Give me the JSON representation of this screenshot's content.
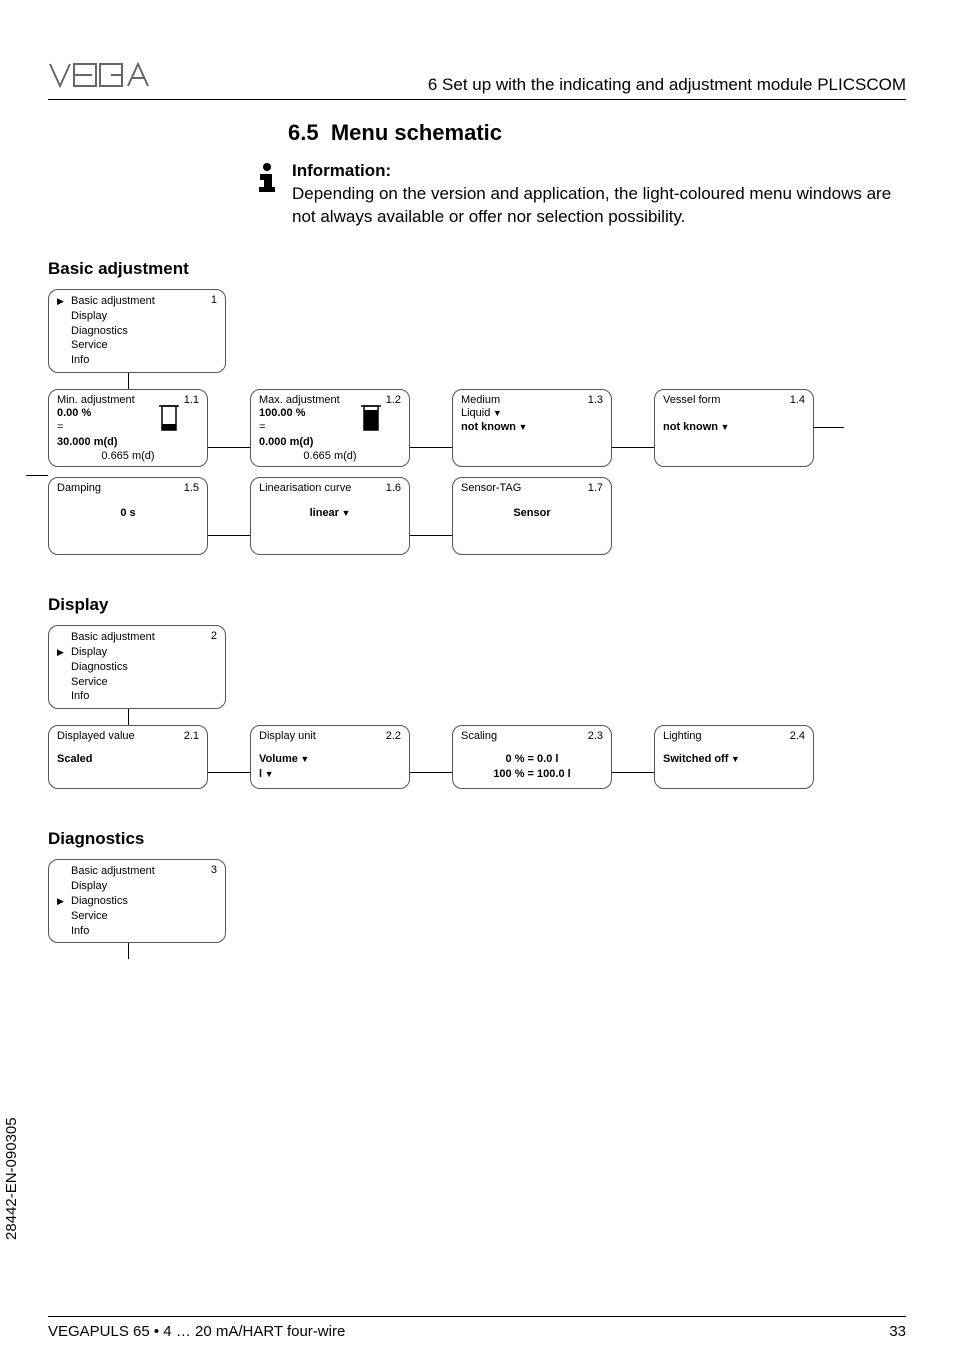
{
  "header": {
    "chapter": "6  Set up with the indicating and adjustment module PLICSCOM"
  },
  "section": {
    "number": "6.5",
    "title": "Menu schematic"
  },
  "info": {
    "label": "Information:",
    "text": "Depending on the version and application, the light-coloured menu windows are not always available or offer nor selection possibility."
  },
  "groups": {
    "basic": {
      "title": "Basic adjustment",
      "menu_num": "1",
      "items": [
        "Basic adjustment",
        "Display",
        "Diagnostics",
        "Service",
        "Info"
      ],
      "row1": {
        "b11": {
          "num": "1.1",
          "title": "Min. adjustment",
          "l1": "0.00 %",
          "l2": "=",
          "l3": "30.000 m(d)",
          "l4": "0.665 m(d)"
        },
        "b12": {
          "num": "1.2",
          "title": "Max. adjustment",
          "l1": "100.00 %",
          "l2": "=",
          "l3": "0.000 m(d)",
          "l4": "0.665 m(d)"
        },
        "b13": {
          "num": "1.3",
          "title": "Medium",
          "l1": "Liquid",
          "l2": "not known"
        },
        "b14": {
          "num": "1.4",
          "title": "Vessel form",
          "l2": "not known"
        }
      },
      "row2": {
        "b15": {
          "num": "1.5",
          "title": "Damping",
          "val": "0 s"
        },
        "b16": {
          "num": "1.6",
          "title": "Linearisation curve",
          "val": "linear"
        },
        "b17": {
          "num": "1.7",
          "title": "Sensor-TAG",
          "val": "Sensor"
        }
      }
    },
    "display": {
      "title": "Display",
      "menu_num": "2",
      "items": [
        "Basic adjustment",
        "Display",
        "Diagnostics",
        "Service",
        "Info"
      ],
      "row": {
        "b21": {
          "num": "2.1",
          "title": "Displayed value",
          "val": "Scaled"
        },
        "b22": {
          "num": "2.2",
          "title": "Display unit",
          "l1": "Volume",
          "l2": "l"
        },
        "b23": {
          "num": "2.3",
          "title": "Scaling",
          "l1": "0 % = 0.0 l",
          "l2": "100 % = 100.0 l"
        },
        "b24": {
          "num": "2.4",
          "title": "Lighting",
          "val": "Switched off"
        }
      }
    },
    "diag": {
      "title": "Diagnostics",
      "menu_num": "3",
      "items": [
        "Basic adjustment",
        "Display",
        "Diagnostics",
        "Service",
        "Info"
      ]
    }
  },
  "footer": {
    "left": "VEGAPULS 65 • 4 … 20 mA/HART four-wire",
    "right": "33"
  },
  "docnum": "28442-EN-090305"
}
